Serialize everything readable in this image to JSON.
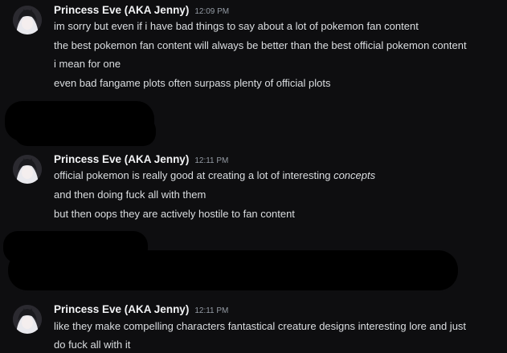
{
  "groups": [
    {
      "username": "Princess Eve (AKA Jenny)",
      "timestamp": "12:09 PM",
      "lines": [
        "im sorry but even if i have bad things to say about a lot of pokemon fan content",
        "the best pokemon fan content will always be better than the best official pokemon content",
        "i mean for one",
        "even bad fangame plots often surpass plenty of official plots"
      ]
    },
    {
      "username": "Princess Eve (AKA Jenny)",
      "timestamp": "12:11 PM",
      "lines": [
        {
          "before": "official pokemon is really good at creating a lot of interesting ",
          "em": "concepts"
        },
        "and then doing fuck all with them",
        "but then oops they are actively hostile to fan content"
      ]
    },
    {
      "username": "Princess Eve (AKA Jenny)",
      "timestamp": "12:11 PM",
      "lines": [
        "like they make compelling characters fantastical creature designs interesting lore and just",
        "do fuck all with it"
      ]
    }
  ],
  "colors": {
    "background": "#0e0e10",
    "username": "#f2f3f5",
    "text": "#dbdee1",
    "timestamp": "#949ba4"
  }
}
